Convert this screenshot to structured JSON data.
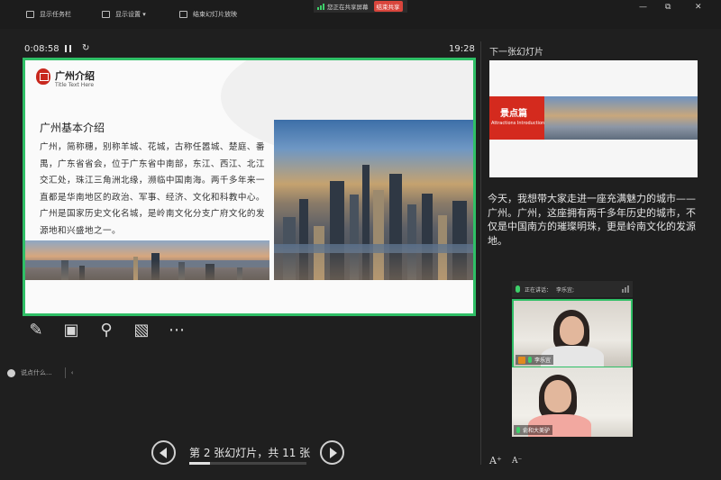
{
  "topbar": {
    "taskbar_label": "显示任务栏",
    "display_settings_label": "显示设置 ▾",
    "end_show_label": "结束幻灯片放映",
    "sharing_status": "您正在共享屏幕",
    "end_share_label": "结束共享",
    "minimize_glyph": "—",
    "restore_glyph": "⧉",
    "close_glyph": "✕"
  },
  "presenter": {
    "elapsed": "0:08:58",
    "clock": "19:28",
    "slide_counter": "第 2 张幻灯片，共 11 张",
    "current_slide": 2,
    "total_slides": 11,
    "progress_fraction": 0.18
  },
  "slide": {
    "title": "广州介绍",
    "subtitle": "Title Text Here",
    "heading": "广州基本介绍",
    "body": "广州，简称穗，别称羊城、花城，古称任嚣城、楚庭、番禺，广东省省会，位于广东省中南部，东江、西江、北江交汇处，珠江三角洲北缘，濒临中国南海。两千多年来一直都是华南地区的政治、军事、经济、文化和科教中心。广州是国家历史文化名城，是岭南文化分支广府文化的发源地和兴盛地之一。"
  },
  "tools": {
    "pen_glyph": "✎",
    "grid_glyph": "▣",
    "zoom_glyph": "⚲",
    "screen_glyph": "▧",
    "more_glyph": "⋯"
  },
  "sidebar_toggle": {
    "label": "说点什么...",
    "chevron": "‹"
  },
  "next_slide": {
    "label": "下一张幻灯片",
    "title": "景点篇",
    "subtitle": "Attractions Introduction"
  },
  "notes": "今天，我想带大家走进一座充满魅力的城市——广州。广州，这座拥有两千多年历史的城市，不仅是中国南方的璀璨明珠，更是岭南文化的发源地。",
  "video": {
    "speaking_label": "正在讲话：",
    "speaking_name": "李乐宜;",
    "participants": [
      {
        "name": "李乐宜",
        "host": true
      },
      {
        "name": "俞和大美驴",
        "host": false
      }
    ]
  },
  "font_controls": {
    "increase": "A⁺",
    "decrease": "A⁻"
  },
  "colors": {
    "accent_green": "#2fbf66",
    "brand_red": "#d42a1e",
    "end_share_red": "#d9453c"
  }
}
